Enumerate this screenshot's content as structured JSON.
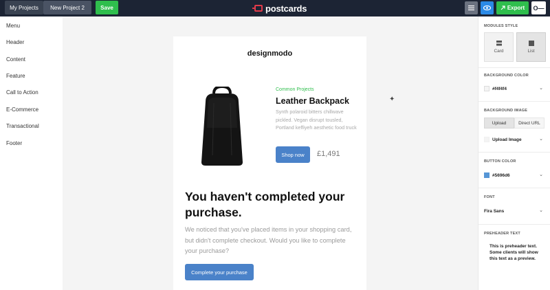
{
  "topbar": {
    "tabs": [
      {
        "label": "My Projects"
      },
      {
        "label": "New Project 2"
      }
    ],
    "save_label": "Save",
    "logo_text": "postcards",
    "export_label": "Export",
    "avatar_text": "O—"
  },
  "sidebar": {
    "items": [
      {
        "label": "Menu"
      },
      {
        "label": "Header"
      },
      {
        "label": "Content"
      },
      {
        "label": "Feature"
      },
      {
        "label": "Call to Action"
      },
      {
        "label": "E-Commerce"
      },
      {
        "label": "Transactional"
      },
      {
        "label": "Footer"
      }
    ]
  },
  "email": {
    "brand": "designmodo",
    "category": "Common Projects",
    "product_title": "Leather Backpack",
    "product_desc": "Synth polaroid bitters chillwave pickled. Vegan disrupt tousled, Portland keffiyeh aesthetic food truck",
    "shop_label": "Shop now",
    "price": "£1,491",
    "headline": "You haven't completed your purchase.",
    "body": "We noticed that you've placed items in your shopping card, but didn't complete checkout. Would you like to complete your purchase?",
    "cta_label": "Complete your purchase"
  },
  "panel": {
    "modules_style_label": "MODULES STYLE",
    "style_options": [
      {
        "label": "Card",
        "selected": false
      },
      {
        "label": "List",
        "selected": true
      }
    ],
    "bg_color_label": "BACKGROUND COLOR",
    "bg_color_value": "#f4f4f4",
    "bg_image_label": "BACKGROUND IMAGE",
    "upload_tab": "Upload",
    "direct_tab": "Direct URL",
    "upload_image_label": "Upload Image",
    "button_color_label": "BUTTON COLOR",
    "button_color_value": "#5696d6",
    "font_label": "FONT",
    "font_value": "Fira Sans",
    "preheader_label": "PREHEADER TEXT",
    "preheader_value": "This is preheader text. Some clients will show this text as a preview."
  },
  "colors": {
    "topbar_bg": "#1c2434",
    "save_green": "#2fbe4d",
    "accent_blue": "#4a82c9",
    "brand_red": "#e23b4a",
    "bg_swatch": "#f4f4f4",
    "button_swatch": "#5696d6"
  }
}
